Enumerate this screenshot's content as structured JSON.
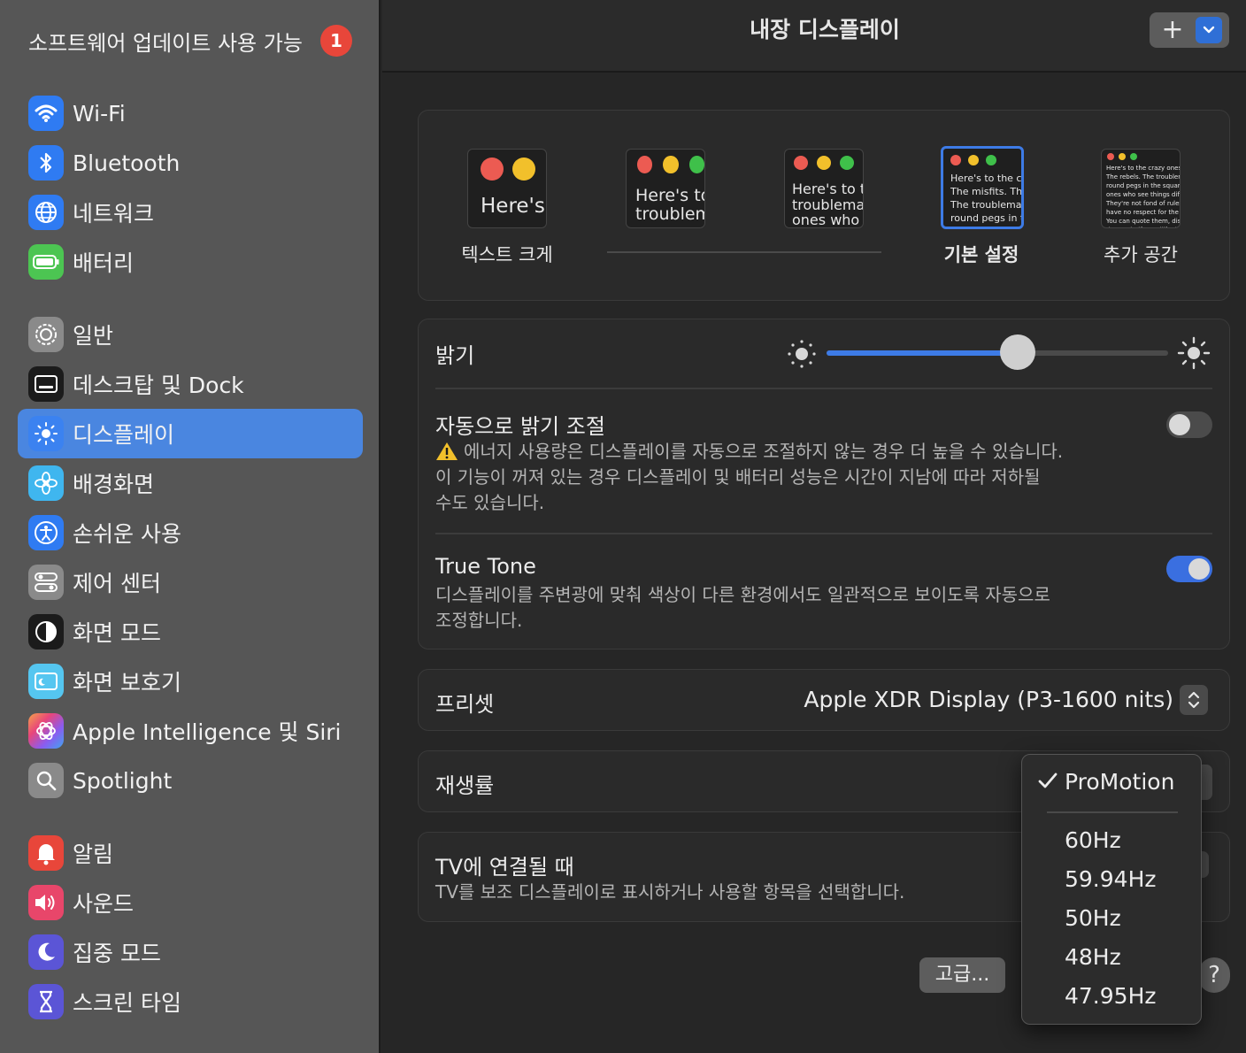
{
  "sidebar": {
    "update_label": "소프트웨어 업데이트 사용 가능",
    "update_badge": "1",
    "items": [
      {
        "label": "Wi-Fi",
        "icon": "wifi-icon",
        "color": "#2f7bf2"
      },
      {
        "label": "Bluetooth",
        "icon": "bluetooth-icon",
        "color": "#2f7bf2"
      },
      {
        "label": "네트워크",
        "icon": "globe-icon",
        "color": "#2f7bf2"
      },
      {
        "label": "배터리",
        "icon": "battery-icon",
        "color": "#4cc552"
      },
      {
        "label": "일반",
        "icon": "gear-icon",
        "color": "#8a8a8a"
      },
      {
        "label": "데스크탑 및 Dock",
        "icon": "dock-icon",
        "color": "#1b1b1b"
      },
      {
        "label": "디스플레이",
        "icon": "display-sun-icon",
        "color": "#3b82f0"
      },
      {
        "label": "배경화면",
        "icon": "wallpaper-flower-icon",
        "color": "#3fb6ef"
      },
      {
        "label": "손쉬운 사용",
        "icon": "accessibility-icon",
        "color": "#2f7bf2"
      },
      {
        "label": "제어 센터",
        "icon": "control-center-icon",
        "color": "#8a8a8a"
      },
      {
        "label": "화면 모드",
        "icon": "appearance-icon",
        "color": "#1b1b1b"
      },
      {
        "label": "화면 보호기",
        "icon": "screensaver-icon",
        "color": "#55c6f0"
      },
      {
        "label": "Apple Intelligence 및 Siri",
        "icon": "siri-icon",
        "color": "#e86b7a"
      },
      {
        "label": "Spotlight",
        "icon": "spotlight-search-icon",
        "color": "#8a8a8a"
      },
      {
        "label": "알림",
        "icon": "bell-icon",
        "color": "#e8463a"
      },
      {
        "label": "사운드",
        "icon": "speaker-icon",
        "color": "#e8466a"
      },
      {
        "label": "집중 모드",
        "icon": "moon-icon",
        "color": "#5b55d6"
      },
      {
        "label": "스크린 타임",
        "icon": "hourglass-icon",
        "color": "#5b55d6"
      }
    ],
    "active_index": 6
  },
  "header": {
    "title": "내장 디스플레이",
    "add_label": "+",
    "chevron": "⌄"
  },
  "resolution": {
    "thumb_texts": [
      "Here's",
      "Here's to the troublemakers",
      "Here's to the troublemakers. The ones who",
      "Here's to the crazy ones. The misfits. The rebels. The troublemakers. The round pegs in the square holes. The ones who see things differently.",
      "Here's to the crazy ones. The misfits. The rebels. The troublemakers. The round pegs in the square holes. The ones who see things differently. They're not fond of rules. And they have no respect for the status quo. You can quote them, disagree with them, glorify or vilify them. About the only thing you can't do is ignore them. Because they change things."
    ],
    "label_left": "텍스트 크게",
    "label_default": "기본 설정",
    "label_more": "추가 공간",
    "selected_index": 3
  },
  "brightness": {
    "label": "밝기",
    "value": 0.56
  },
  "auto_brightness": {
    "title": "자동으로 밝기 조절",
    "warning_icon": "warning-triangle-icon",
    "description": "에너지 사용량은 디스플레이를 자동으로 조절하지 않는 경우 더 높을 수 있습니다. 이 기능이 꺼져 있는 경우 디스플레이 및 배터리 성능은 시간이 지남에 따라 저하될 수도 있습니다.",
    "line1": "에너지 사용량은 디스플레이를 자동으로 조절하지 않는 경우 더 높을 수 있습니다.",
    "line2": "이 기능이 꺼져 있는 경우 디스플레이 및 배터리 성능은 시간이 지남에 따라 저하될",
    "line3": "수도 있습니다.",
    "enabled": false
  },
  "true_tone": {
    "title": "True Tone",
    "line1": "디스플레이를 주변광에 맞춰 색상이 다른 환경에서도 일관적으로 보이도록 자동으로",
    "line2": "조정합니다.",
    "enabled": true
  },
  "preset": {
    "label": "프리셋",
    "value": "Apple XDR Display (P3-1600 nits)"
  },
  "refresh_rate": {
    "label": "재생률",
    "options": [
      "ProMotion",
      "60Hz",
      "59.94Hz",
      "50Hz",
      "48Hz",
      "47.95Hz"
    ],
    "selected": "ProMotion"
  },
  "tv": {
    "title": "TV에 연결될 때",
    "description": "TV를 보조 디스플레이로 표시하거나 사용할 항목을 선택합니다."
  },
  "footer": {
    "advanced_label": "고급...",
    "help_label": "?"
  },
  "colors": {
    "accent": "#3d7be6",
    "toggle_on": "#3a6fe0",
    "toggle_off": "#4b4b4b",
    "badge": "#e8463a"
  }
}
